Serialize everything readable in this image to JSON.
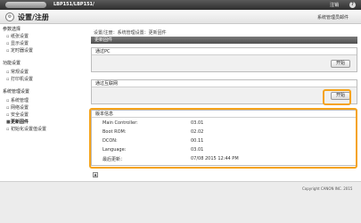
{
  "topbar": {
    "model": "LBP151/LBP151/",
    "logout_label": "注销",
    "help_icon": "?"
  },
  "header": {
    "title": "设置/注册",
    "mail_link": "系统管理员邮件"
  },
  "sidebar": {
    "sections": [
      {
        "title": "参数选择",
        "items": [
          "纸张设置",
          "显示设置",
          "定时器设置"
        ]
      },
      {
        "title": "功能设置",
        "items": [
          "常规设置",
          "打印机设置"
        ]
      },
      {
        "title": "系统管理设置",
        "items": [
          "系统管理",
          "网络设置",
          "安全设置",
          "更新固件",
          "初始化设置值设置"
        ]
      }
    ],
    "active_item": "更新固件"
  },
  "main": {
    "breadcrumb": "设置/注册：系统管理设置：更新固件",
    "page_title": "更新固件",
    "via_pc": {
      "title": "通过PC",
      "button": "开始"
    },
    "via_internet": {
      "title": "通过互联网",
      "button": "开始"
    },
    "version_info": {
      "title": "版本信息",
      "rows": [
        {
          "label": "Main Controller:",
          "value": "03.01"
        },
        {
          "label": "Boot ROM:",
          "value": "02.02"
        },
        {
          "label": "DCON:",
          "value": "00.11"
        },
        {
          "label": "Language:",
          "value": "03.01"
        },
        {
          "label": "最后更新：",
          "value": "07/08 2015 12:44 PM"
        }
      ]
    }
  },
  "footer": {
    "copyright": "Copyright CANON INC. 2015"
  },
  "colors": {
    "highlight": "#f5a31a",
    "topbar": "#3a3a3a",
    "page_header": "#5f5f5f"
  }
}
